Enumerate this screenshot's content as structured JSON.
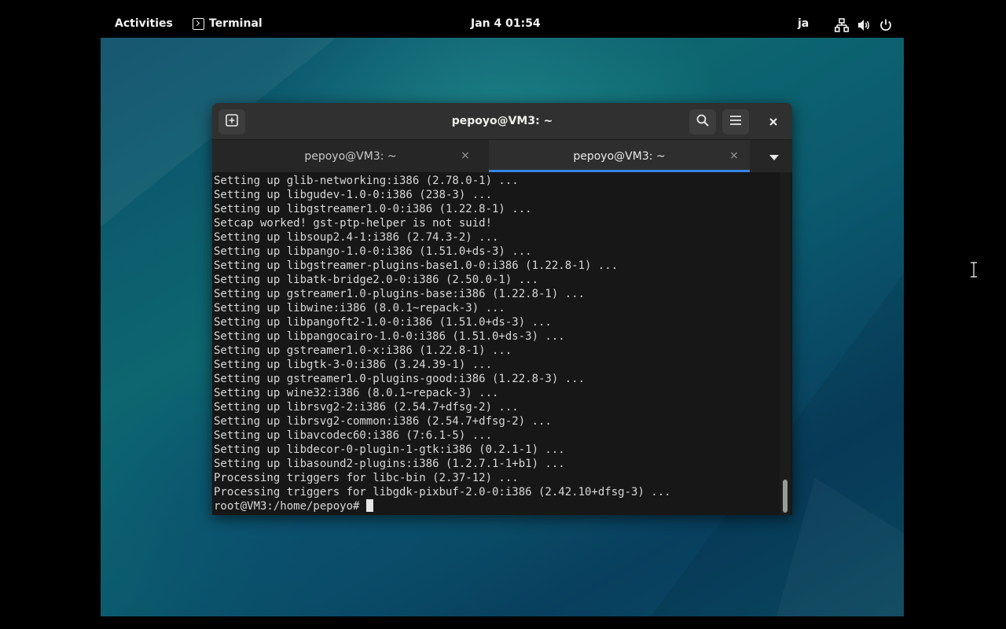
{
  "topbar": {
    "activities": "Activities",
    "app_name": "Terminal",
    "clock": "Jan 4  01:54",
    "language": "ja",
    "tray_icons": [
      "network-icon",
      "volume-icon",
      "power-icon"
    ]
  },
  "window": {
    "title": "pepoyo@VM3: ~",
    "tabs": [
      {
        "label": "pepoyo@VM3: ~",
        "active": false
      },
      {
        "label": "pepoyo@VM3: ~",
        "active": true
      }
    ],
    "tab_close_glyph": "×",
    "close_glyph": "×"
  },
  "terminal": {
    "lines": [
      "Setting up glib-networking:i386 (2.78.0-1) ...",
      "Setting up libgudev-1.0-0:i386 (238-3) ...",
      "Setting up libgstreamer1.0-0:i386 (1.22.8-1) ...",
      "Setcap worked! gst-ptp-helper is not suid!",
      "Setting up libsoup2.4-1:i386 (2.74.3-2) ...",
      "Setting up libpango-1.0-0:i386 (1.51.0+ds-3) ...",
      "Setting up libgstreamer-plugins-base1.0-0:i386 (1.22.8-1) ...",
      "Setting up libatk-bridge2.0-0:i386 (2.50.0-1) ...",
      "Setting up gstreamer1.0-plugins-base:i386 (1.22.8-1) ...",
      "Setting up libwine:i386 (8.0.1~repack-3) ...",
      "Setting up libpangoft2-1.0-0:i386 (1.51.0+ds-3) ...",
      "Setting up libpangocairo-1.0-0:i386 (1.51.0+ds-3) ...",
      "Setting up gstreamer1.0-x:i386 (1.22.8-1) ...",
      "Setting up libgtk-3-0:i386 (3.24.39-1) ...",
      "Setting up gstreamer1.0-plugins-good:i386 (1.22.8-3) ...",
      "Setting up wine32:i386 (8.0.1~repack-3) ...",
      "Setting up librsvg2-2:i386 (2.54.7+dfsg-2) ...",
      "Setting up librsvg2-common:i386 (2.54.7+dfsg-2) ...",
      "Setting up libavcodec60:i386 (7:6.1-5) ...",
      "Setting up libdecor-0-plugin-1-gtk:i386 (0.2.1-1) ...",
      "Setting up libasound2-plugins:i386 (1.2.7.1-1+b1) ...",
      "Processing triggers for libc-bin (2.37-12) ...",
      "Processing triggers for libgdk-pixbuf-2.0-0:i386 (2.42.10+dfsg-3) ..."
    ],
    "prompt": "root@VM3:/home/pepoyo# "
  }
}
